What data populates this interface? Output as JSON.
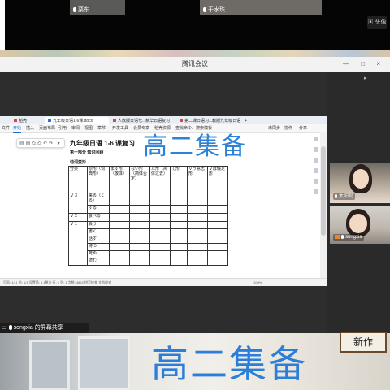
{
  "participants_top": [
    {
      "name": "栗东"
    },
    {
      "name": "于水珠"
    }
  ],
  "camera_button": {
    "icon": "camera-icon",
    "label": "头像"
  },
  "window": {
    "title": "腾讯会议",
    "controls": "— □ ×"
  },
  "doc_tabs": [
    {
      "label": "稻壳",
      "color": "#d9463b"
    },
    {
      "label": "九年级日语1-6课.docx",
      "color": "#2b6fd6",
      "active": true
    },
    {
      "label": "人教版日语七...精华日语复习",
      "color": "#d9463b"
    },
    {
      "label": "第二课日语习...教版九年级日语",
      "color": "#d9463b"
    }
  ],
  "menu_items": [
    "文件",
    "开始",
    "插入",
    "页面布局",
    "引用",
    "审阅",
    "视图",
    "章节",
    "开发工具",
    "会员专享",
    "稻壳资源",
    "查找命令、搜索模板"
  ],
  "menu_right": [
    "未同步",
    "协作",
    "分享"
  ],
  "overlay_title": "高二集备",
  "document": {
    "title": "九年级日语 1-6 课复习",
    "part": "第一部分  知识回顾",
    "heading": "动词变形",
    "table": {
      "headers": [
        "分类",
        "原形（词典形）",
        "ます形（敬体）",
        "ない形（简体否定）",
        "た形（简体过去）",
        "て形",
        "ｖう意志形",
        "Ｖば假定形"
      ],
      "rows": [
        {
          "group": "Ｖ３",
          "verbs": [
            "来る（くる）",
            "する"
          ]
        },
        {
          "group": "Ｖ２",
          "verbs": [
            "食べる"
          ]
        },
        {
          "group": "Ｖ１",
          "verbs": [
            "会う",
            "書く",
            "話す",
            "待つ",
            "死ぬ",
            "読む"
          ]
        }
      ]
    }
  },
  "statusbar": {
    "left": "页面: 1/11   节: 1/1   设置值: 6.1厘米   行: 1   列: 1   字数: 4862   拼写检查   文档校对",
    "zoom": "100%"
  },
  "share_bar": {
    "label": "songxia 的屏幕共享"
  },
  "side_participants": [
    {
      "name": "太阳鸟"
    },
    {
      "name": "songxia"
    }
  ],
  "photo": {
    "title": "高二集备",
    "plaque_text": "新作"
  }
}
